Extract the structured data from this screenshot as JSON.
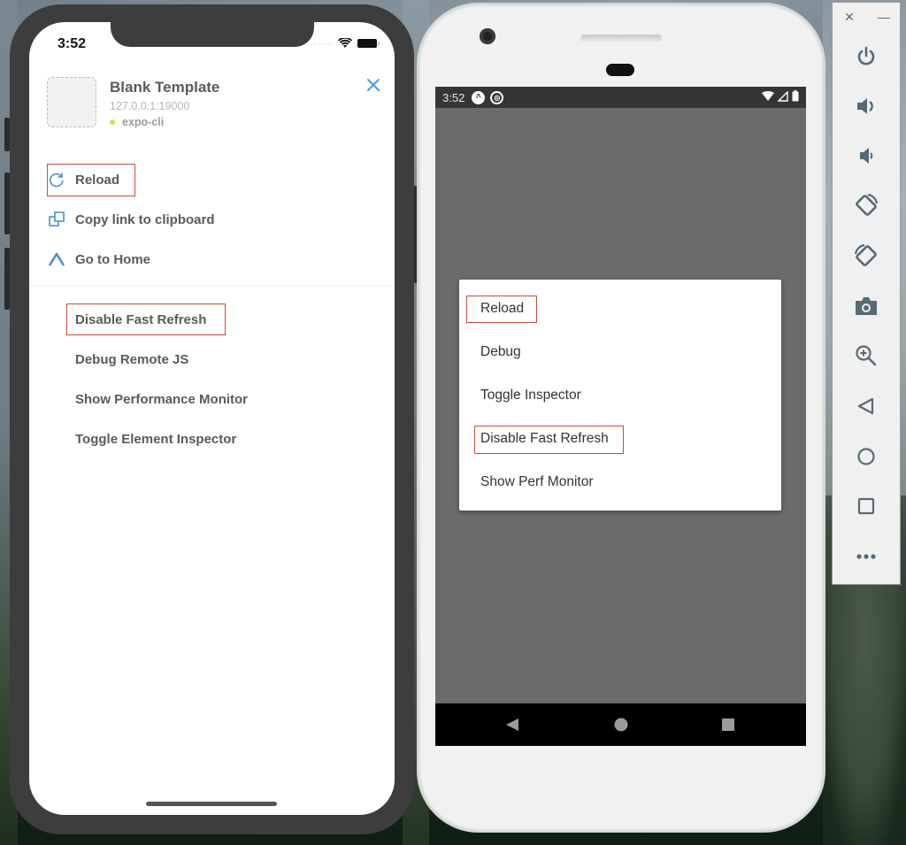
{
  "ios": {
    "status": {
      "time": "3:52"
    },
    "app": {
      "title": "Blank Template",
      "url": "127.0.0.1:19000",
      "cli": "expo-cli",
      "status_dot_color": "#dadb4a"
    },
    "actions": [
      {
        "label": "Reload",
        "icon": "reload-icon",
        "highlighted": true
      },
      {
        "label": "Copy link to clipboard",
        "icon": "copy-icon",
        "highlighted": false
      },
      {
        "label": "Go to Home",
        "icon": "expo-home-icon",
        "highlighted": false
      }
    ],
    "dev_menu": [
      {
        "label": "Disable Fast Refresh",
        "highlighted": true
      },
      {
        "label": "Debug Remote JS",
        "highlighted": false
      },
      {
        "label": "Show Performance Monitor",
        "highlighted": false
      },
      {
        "label": "Toggle Element Inspector",
        "highlighted": false
      }
    ],
    "accent": "#4a8fd6"
  },
  "android": {
    "status": {
      "time": "3:52"
    },
    "dev_menu": [
      {
        "label": "Reload",
        "highlighted": true
      },
      {
        "label": "Debug",
        "highlighted": false
      },
      {
        "label": "Toggle Inspector",
        "highlighted": false
      },
      {
        "label": "Disable Fast Refresh",
        "highlighted": true
      },
      {
        "label": "Show Perf Monitor",
        "highlighted": false
      }
    ]
  },
  "emulator_toolbar": {
    "window_controls": [
      "close-icon",
      "minimize-icon"
    ],
    "buttons": [
      "power-icon",
      "volume-up-icon",
      "volume-down-icon",
      "rotate-left-icon",
      "rotate-right-icon",
      "camera-icon",
      "zoom-icon",
      "back-icon",
      "home-icon",
      "overview-icon",
      "more-icon"
    ]
  },
  "highlight_color": "#d04a3a"
}
